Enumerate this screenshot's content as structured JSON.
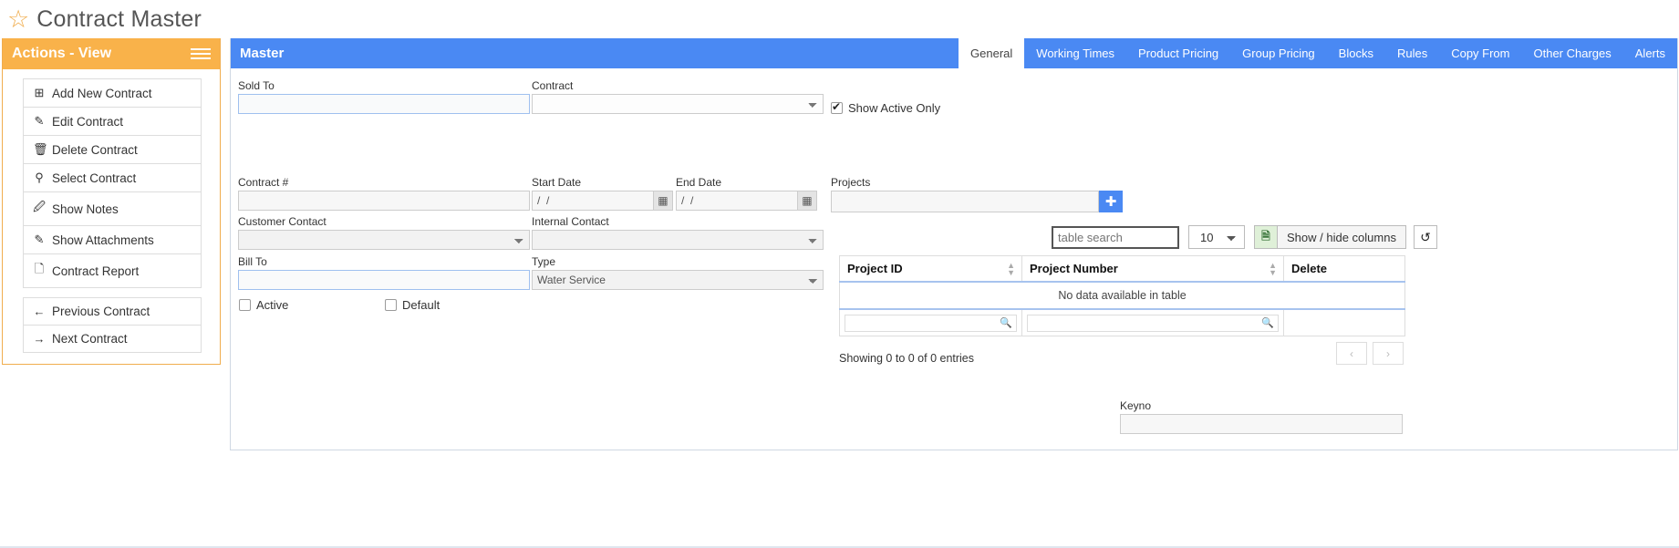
{
  "header": {
    "title": "Contract Master",
    "star_icon": "star-icon"
  },
  "sidebar": {
    "heading": "Actions - View",
    "menu_icon": "hamburger-icon",
    "groups": [
      {
        "items": [
          {
            "icon": "plus-square-icon",
            "glyph": "⊞",
            "label": "Add New Contract"
          },
          {
            "icon": "pencil-icon",
            "glyph": "✎",
            "label": "Edit Contract"
          },
          {
            "icon": "trash-icon",
            "glyph": "🗑",
            "label": "Delete Contract"
          },
          {
            "icon": "pin-icon",
            "glyph": "⊺",
            "label": "Select Contract"
          },
          {
            "icon": "edit-note-icon",
            "glyph": "☑",
            "label": "Show Notes"
          },
          {
            "icon": "paperclip-icon",
            "glyph": "✎",
            "label": "Show Attachments"
          },
          {
            "icon": "file-report-icon",
            "glyph": "❐",
            "label": "Contract Report"
          }
        ]
      },
      {
        "items": [
          {
            "icon": "arrow-left-icon",
            "glyph": "←",
            "label": "Previous Contract"
          },
          {
            "icon": "arrow-right-icon",
            "glyph": "→",
            "label": "Next Contract"
          }
        ]
      }
    ]
  },
  "main": {
    "panel_title": "Master",
    "tabs": [
      {
        "label": "General",
        "active": true
      },
      {
        "label": "Working Times",
        "active": false
      },
      {
        "label": "Product Pricing",
        "active": false
      },
      {
        "label": "Group Pricing",
        "active": false
      },
      {
        "label": "Blocks",
        "active": false
      },
      {
        "label": "Rules",
        "active": false
      },
      {
        "label": "Copy From",
        "active": false
      },
      {
        "label": "Other Charges",
        "active": false
      },
      {
        "label": "Alerts",
        "active": false
      }
    ],
    "form": {
      "sold_to": {
        "label": "Sold To",
        "value": ""
      },
      "contract": {
        "label": "Contract",
        "value": ""
      },
      "show_active_only": {
        "label": "Show Active Only",
        "checked": true
      },
      "contract_no": {
        "label": "Contract #",
        "value": ""
      },
      "start_date": {
        "label": "Start Date",
        "value": "/  /",
        "calendar_icon": "calendar-icon"
      },
      "end_date": {
        "label": "End Date",
        "value": "/  /",
        "calendar_icon": "calendar-icon"
      },
      "projects": {
        "label": "Projects",
        "value": "",
        "add_icon": "plus-icon"
      },
      "customer_contact": {
        "label": "Customer Contact",
        "value": ""
      },
      "internal_contact": {
        "label": "Internal Contact",
        "value": ""
      },
      "bill_to": {
        "label": "Bill To",
        "value": ""
      },
      "type": {
        "label": "Type",
        "value": "Water Service"
      },
      "active": {
        "label": "Active",
        "checked": false
      },
      "default": {
        "label": "Default",
        "checked": false
      },
      "keyno": {
        "label": "Keyno",
        "value": ""
      }
    },
    "table": {
      "search_placeholder": "table search",
      "page_length": "10",
      "page_length_options": [
        "10"
      ],
      "export_icon": "excel-icon",
      "columns_button": "Show / hide columns",
      "reload_icon": "reload-icon",
      "headers": [
        "Project ID",
        "Project Number",
        "Delete"
      ],
      "empty_text": "No data available in table",
      "column_filters": [
        "",
        "",
        ""
      ],
      "filter_icon": "magnifier-icon",
      "info": "Showing 0 to 0 of 0 entries",
      "prev_icon": "chevron-left-icon",
      "next_icon": "chevron-right-icon"
    }
  },
  "colors": {
    "accent_blue": "#4a89f3",
    "accent_orange": "#f9b24a",
    "excel_green": "#dff0d8"
  }
}
